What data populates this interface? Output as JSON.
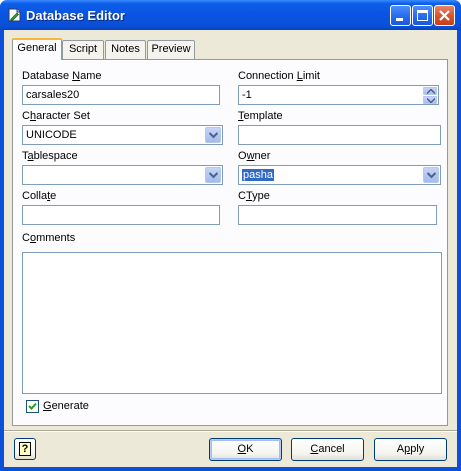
{
  "window": {
    "title": "Database Editor"
  },
  "tabs": [
    {
      "label": "General",
      "active": true
    },
    {
      "label": "Script",
      "active": false
    },
    {
      "label": "Notes",
      "active": false
    },
    {
      "label": "Preview",
      "active": false
    }
  ],
  "form": {
    "database_name": {
      "label_pre": "Database ",
      "label_ul": "N",
      "label_post": "ame",
      "value": "carsales20"
    },
    "connection_limit": {
      "label_pre": "Connection ",
      "label_ul": "L",
      "label_post": "imit",
      "value": "-1"
    },
    "character_set": {
      "label_pre": "C",
      "label_ul": "h",
      "label_post": "aracter Set",
      "value": "UNICODE"
    },
    "template": {
      "label_pre": "",
      "label_ul": "T",
      "label_post": "emplate",
      "value": ""
    },
    "tablespace": {
      "label_pre": "T",
      "label_ul": "a",
      "label_post": "blespace",
      "value": ""
    },
    "owner": {
      "label_pre": "O",
      "label_ul": "w",
      "label_post": "ner",
      "value": "pasha"
    },
    "collate": {
      "label_pre": "Colla",
      "label_ul": "t",
      "label_post": "e",
      "value": ""
    },
    "ctype": {
      "label_pre": "C",
      "label_ul": "T",
      "label_post": "ype",
      "value": ""
    },
    "comments": {
      "label_pre": "C",
      "label_ul": "o",
      "label_post": "mments",
      "value": ""
    },
    "generate": {
      "label_pre": "",
      "label_ul": "G",
      "label_post": "enerate",
      "checked": true
    }
  },
  "buttons": {
    "help": "?",
    "ok": {
      "label_pre": "",
      "label_ul": "O",
      "label_post": "K"
    },
    "cancel": {
      "label_pre": "",
      "label_ul": "C",
      "label_post": "ancel"
    },
    "apply": {
      "label_pre": "A",
      "label_ul": "p",
      "label_post": "ply"
    }
  },
  "colors": {
    "title_bar": "#0a54e2",
    "dialog_bg": "#ece9d8",
    "active_tab_accent": "#f8b738",
    "selection": "#316ac5"
  }
}
